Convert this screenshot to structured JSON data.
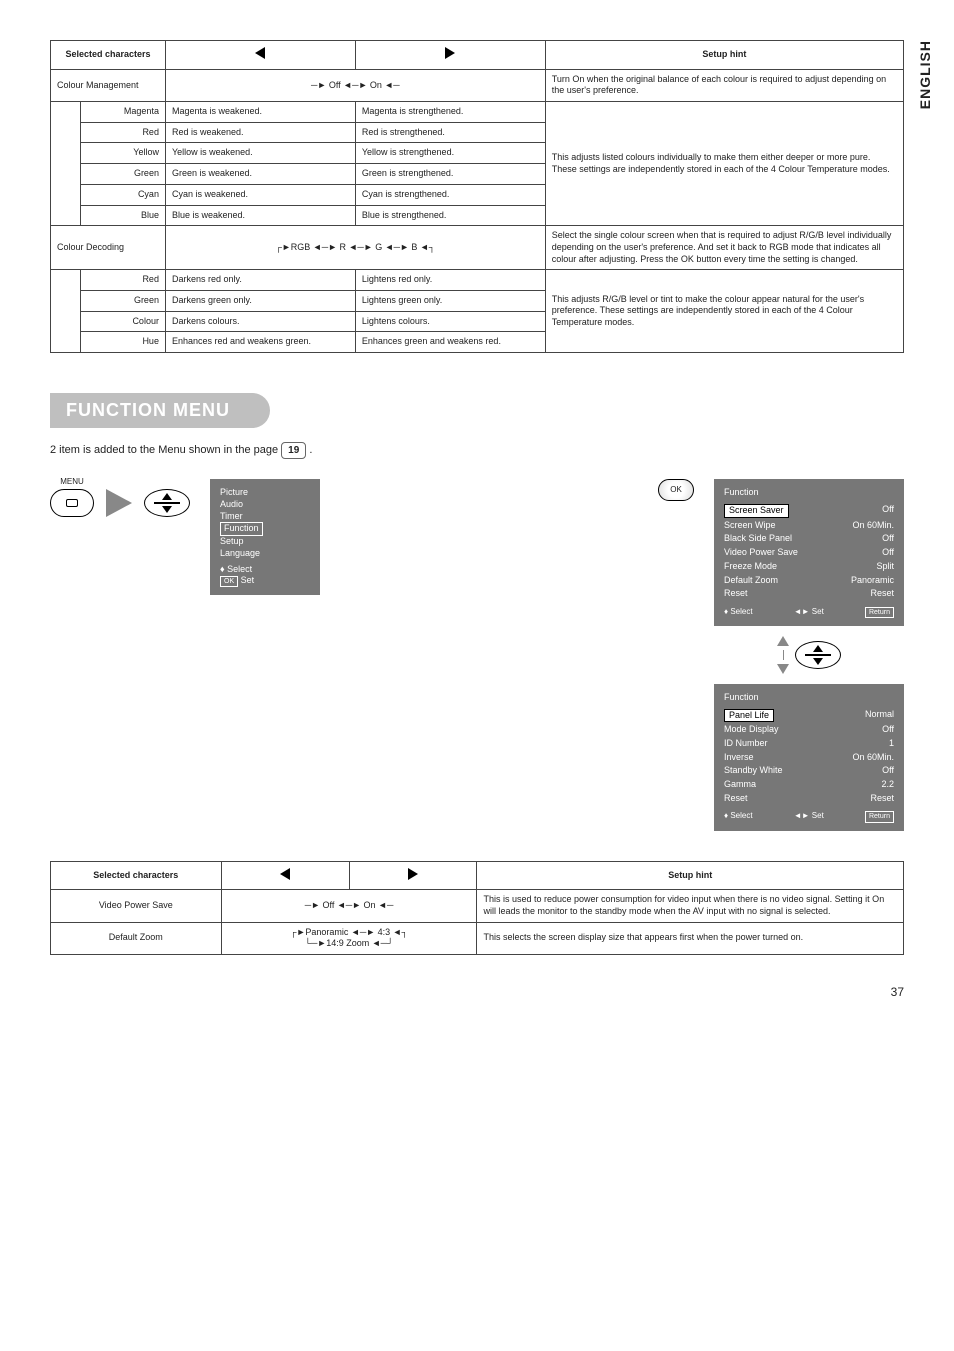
{
  "vert_label": "ENGLISH",
  "table1": {
    "headers": {
      "sel": "Selected characters",
      "setup": "Setup hint"
    },
    "colour_mgmt": {
      "label": "Colour Management",
      "cycle": "Off ◄─► On",
      "hint": "Turn On when the original balance of each colour is required to adjust depending on the user's preference.",
      "group_hint": "This adjusts listed colours individually to make them either deeper or more pure. These settings are independently stored in each of the 4 Colour Temperature modes.",
      "rows": [
        {
          "name": "Magenta",
          "l": "Magenta is weakened.",
          "r": "Magenta is strengthened."
        },
        {
          "name": "Red",
          "l": "Red is weakened.",
          "r": "Red is strengthened."
        },
        {
          "name": "Yellow",
          "l": "Yellow is weakened.",
          "r": "Yellow is strengthened."
        },
        {
          "name": "Green",
          "l": "Green is weakened.",
          "r": "Green is strengthened."
        },
        {
          "name": "Cyan",
          "l": "Cyan is weakened.",
          "r": "Cyan is strengthened."
        },
        {
          "name": "Blue",
          "l": "Blue is weakened.",
          "r": "Blue is strengthened."
        }
      ]
    },
    "colour_dec": {
      "label": "Colour Decoding",
      "cycle": "RGB ◄─► R ◄─► G ◄─► B",
      "hint": "Select the single colour screen when that is required to adjust R/G/B level individually depending on the user's preference. And set it back to RGB mode that indicates all colour after adjusting. Press the OK button every time the setting is changed.",
      "group_hint": "This adjusts R/G/B level or tint to make the colour appear natural for the user's preference. These settings are independently stored in each of the 4 Colour Temperature modes.",
      "rows": [
        {
          "name": "Red",
          "l": "Darkens red only.",
          "r": "Lightens red only."
        },
        {
          "name": "Green",
          "l": "Darkens green only.",
          "r": "Lightens green only."
        },
        {
          "name": "Colour",
          "l": "Darkens colours.",
          "r": "Lightens colours."
        },
        {
          "name": "Hue",
          "l": "Enhances red and weakens green.",
          "r": "Enhances green and weakens red."
        }
      ]
    }
  },
  "section_title": "FUNCTION MENU",
  "note_prefix": "2 item is added to the Menu shown in the page ",
  "note_page": "19",
  "note_suffix": " .",
  "menu_label": "MENU",
  "ok_label": "OK",
  "menu_list": {
    "items": [
      "Picture",
      "Audio",
      "Timer",
      "Function",
      "Setup",
      "Language"
    ],
    "highlight": "Function",
    "foot_select": "Select",
    "foot_set": "Set",
    "foot_ok": "OK"
  },
  "osd1": {
    "title": "Function",
    "rows": [
      {
        "k": "Screen Saver",
        "v": "Off",
        "hi": true
      },
      {
        "k": "Screen Wipe",
        "v": "On  60Min."
      },
      {
        "k": "Black Side Panel",
        "v": "Off"
      },
      {
        "k": "Video Power Save",
        "v": "Off"
      },
      {
        "k": "Freeze Mode",
        "v": "Split"
      },
      {
        "k": "Default Zoom",
        "v": "Panoramic"
      },
      {
        "k": "Reset",
        "v": "Reset"
      }
    ],
    "foot": {
      "select": "Select",
      "set": "Set",
      "ret": "Return"
    }
  },
  "osd2": {
    "title": "Function",
    "rows": [
      {
        "k": "Panel Life",
        "v": "Normal",
        "hi": true
      },
      {
        "k": "Mode Display",
        "v": "Off"
      },
      {
        "k": "ID Number",
        "v": "1"
      },
      {
        "k": "Inverse",
        "v": "On  60Min."
      },
      {
        "k": "Standby White",
        "v": "Off"
      },
      {
        "k": "Gamma",
        "v": "2.2"
      },
      {
        "k": "Reset",
        "v": "Reset"
      }
    ],
    "foot": {
      "select": "Select",
      "set": "Set",
      "ret": "Return"
    }
  },
  "table2": {
    "headers": {
      "sel": "Selected characters",
      "setup": "Setup hint"
    },
    "rows": [
      {
        "name": "Video Power Save",
        "cycle": "Off ◄─► On",
        "hint": "This is used to reduce power consumption for video input when there is no video signal. Setting it On will leads the monitor to the standby mode when the AV input with no signal is selected."
      },
      {
        "name": "Default Zoom",
        "cycle": "Panoramic ◄─► 4:3\n14:9 Zoom",
        "hint": "This selects the screen display size that appears first when the power turned on."
      }
    ]
  },
  "page_number": "37"
}
